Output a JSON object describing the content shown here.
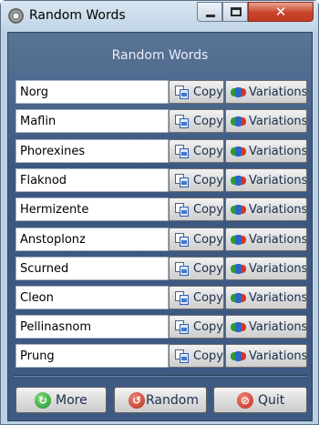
{
  "window": {
    "title": "Random Words",
    "icon": "gear-icon",
    "controls": {
      "minimize": "minimize-icon",
      "maximize": "maximize-icon",
      "close": "close-icon",
      "close_glyph": "✕"
    }
  },
  "heading": "Random Words",
  "words": [
    {
      "word": "Norg",
      "copy_label": "Copy",
      "variations_label": "Variations"
    },
    {
      "word": "Maflin",
      "copy_label": "Copy",
      "variations_label": "Variations"
    },
    {
      "word": "Phorexines",
      "copy_label": "Copy",
      "variations_label": "Variations"
    },
    {
      "word": "Flaknod",
      "copy_label": "Copy",
      "variations_label": "Variations"
    },
    {
      "word": "Hermizente",
      "copy_label": "Copy",
      "variations_label": "Variations"
    },
    {
      "word": "Anstoplonz",
      "copy_label": "Copy",
      "variations_label": "Variations"
    },
    {
      "word": "Scurned",
      "copy_label": "Copy",
      "variations_label": "Variations"
    },
    {
      "word": "Cleon",
      "copy_label": "Copy",
      "variations_label": "Variations"
    },
    {
      "word": "Pellinasnom",
      "copy_label": "Copy",
      "variations_label": "Variations"
    },
    {
      "word": "Prung",
      "copy_label": "Copy",
      "variations_label": "Variations"
    }
  ],
  "icons": {
    "copy": "copy-icon",
    "variations": "variations-icon"
  },
  "footer": {
    "more_label": "More",
    "more_icon": "refresh-icon",
    "random_label": "Random",
    "random_icon": "shuffle-icon",
    "quit_label": "Quit",
    "quit_icon": "no-entry-icon"
  },
  "colors": {
    "panel": "#3f5a82",
    "titlebar": "#c1d4e7",
    "close_button": "#c8432b"
  }
}
